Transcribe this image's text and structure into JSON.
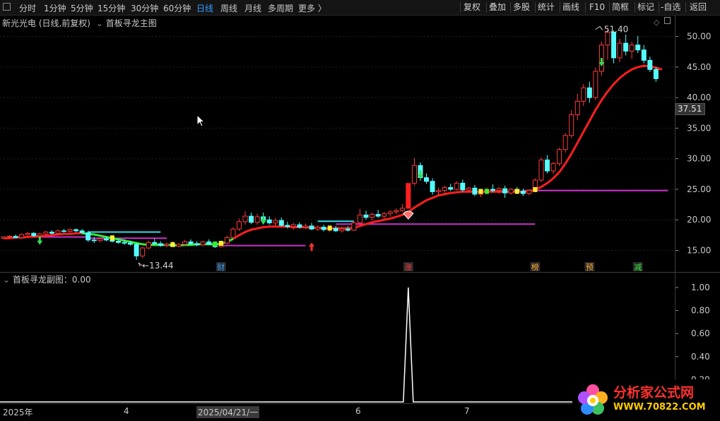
{
  "topbar": {
    "periods": [
      "分时",
      "1分钟",
      "5分钟",
      "15分钟",
      "30分钟",
      "60分钟",
      "日线",
      "周线",
      "月线",
      "多周期",
      "更多 〉"
    ],
    "active_period": "日线",
    "tools": [
      "复权",
      "叠加",
      "多股",
      "统计",
      "画线",
      "F10",
      "简框",
      "标记",
      "-自选",
      "返回"
    ]
  },
  "main": {
    "stock_title": "新光光电 (日线,前复权)",
    "indicator_name": "首板寻龙主图",
    "price_ticks": [
      "50.00",
      "45.00",
      "40.00",
      "35.00",
      "30.00",
      "25.00",
      "20.00",
      "15.00"
    ],
    "current_price_label": "37.51",
    "high_label": "51.40",
    "low_label": "13.44",
    "markers": [
      "财",
      "涨",
      "榜",
      "预",
      "减"
    ],
    "colors": {
      "up": "#ff3c3c",
      "down": "#54ffff",
      "ma": "#ff1e1e",
      "support": "#cc33cc",
      "cyan_line": "#33ddee",
      "green_line": "#33ee33",
      "background": "#000000"
    }
  },
  "sub": {
    "title": "首板寻龙副图：0.00",
    "ticks": [
      "1.00",
      "0.80",
      "0.60",
      "0.40",
      "0.20"
    ]
  },
  "xaxis": {
    "labels": [
      "2025年",
      "4",
      "2025/04/21/一",
      "6",
      "7"
    ]
  },
  "watermark": {
    "line1": "分析家公式网",
    "line2": "WWW.70822.COM"
  },
  "chart_data": {
    "type": "candlestick",
    "title": "新光光电 (日线,前复权)",
    "ylim": [
      12,
      53
    ],
    "price_ticks": [
      15,
      20,
      25,
      30,
      35,
      40,
      45,
      50
    ],
    "high": 51.4,
    "low": 13.44,
    "last": 37.51,
    "candles": [
      [
        17.0,
        17.3,
        16.8,
        17.2
      ],
      [
        17.2,
        17.5,
        17.0,
        17.3
      ],
      [
        17.3,
        17.6,
        17.0,
        17.1
      ],
      [
        17.1,
        17.8,
        17.0,
        17.6
      ],
      [
        17.6,
        18.0,
        17.4,
        17.8
      ],
      [
        17.8,
        18.0,
        17.2,
        17.4
      ],
      [
        17.4,
        17.9,
        17.2,
        17.7
      ],
      [
        17.7,
        18.2,
        17.5,
        18.0
      ],
      [
        18.0,
        18.3,
        17.6,
        17.8
      ],
      [
        17.8,
        18.4,
        17.6,
        18.2
      ],
      [
        18.2,
        18.5,
        17.9,
        18.1
      ],
      [
        18.1,
        18.6,
        17.9,
        18.4
      ],
      [
        18.4,
        18.6,
        18.0,
        18.2
      ],
      [
        18.2,
        18.5,
        17.8,
        17.9
      ],
      [
        17.9,
        18.2,
        16.4,
        16.7
      ],
      [
        16.7,
        17.2,
        16.2,
        16.6
      ],
      [
        16.6,
        17.1,
        16.3,
        16.9
      ],
      [
        16.9,
        17.3,
        16.5,
        16.7
      ],
      [
        16.7,
        17.0,
        16.3,
        16.5
      ],
      [
        16.5,
        16.9,
        16.1,
        16.3
      ],
      [
        16.3,
        16.8,
        15.9,
        16.2
      ],
      [
        16.2,
        16.6,
        15.8,
        16.0
      ],
      [
        16.0,
        16.3,
        13.44,
        14.1
      ],
      [
        14.1,
        15.6,
        13.8,
        15.4
      ],
      [
        15.4,
        16.6,
        15.2,
        16.3
      ],
      [
        16.3,
        16.9,
        15.9,
        16.1
      ],
      [
        16.1,
        16.5,
        15.6,
        15.8
      ],
      [
        15.8,
        16.3,
        15.5,
        16.0
      ],
      [
        16.0,
        16.4,
        15.6,
        15.7
      ],
      [
        15.7,
        16.2,
        15.5,
        16.0
      ],
      [
        16.0,
        16.7,
        15.8,
        16.4
      ],
      [
        16.4,
        16.8,
        15.9,
        16.1
      ],
      [
        16.1,
        16.5,
        15.7,
        15.9
      ],
      [
        15.9,
        16.6,
        15.7,
        16.4
      ],
      [
        16.4,
        16.8,
        15.9,
        16.0
      ],
      [
        16.0,
        16.4,
        15.4,
        15.6
      ],
      [
        15.6,
        16.4,
        15.5,
        16.2
      ],
      [
        16.2,
        17.4,
        16.0,
        17.1
      ],
      [
        17.1,
        18.8,
        16.9,
        18.5
      ],
      [
        18.5,
        20.2,
        18.2,
        19.7
      ],
      [
        19.7,
        21.4,
        19.2,
        20.6
      ],
      [
        20.6,
        21.2,
        19.3,
        19.6
      ],
      [
        19.6,
        21.0,
        19.2,
        20.5
      ],
      [
        20.5,
        21.2,
        19.7,
        20.0
      ],
      [
        20.0,
        20.6,
        19.2,
        19.5
      ],
      [
        19.5,
        20.3,
        19.0,
        19.9
      ],
      [
        19.9,
        20.4,
        18.9,
        19.1
      ],
      [
        19.1,
        19.7,
        18.6,
        18.9
      ],
      [
        18.9,
        19.5,
        18.4,
        19.2
      ],
      [
        19.2,
        19.6,
        18.6,
        18.8
      ],
      [
        18.8,
        19.4,
        18.5,
        19.0
      ],
      [
        19.0,
        19.5,
        18.3,
        18.5
      ],
      [
        18.5,
        19.1,
        18.2,
        18.8
      ],
      [
        18.8,
        19.2,
        18.1,
        18.4
      ],
      [
        18.4,
        18.9,
        18.0,
        18.6
      ],
      [
        18.6,
        19.0,
        18.0,
        18.2
      ],
      [
        18.2,
        18.8,
        17.9,
        18.5
      ],
      [
        18.5,
        19.0,
        18.1,
        18.3
      ],
      [
        18.3,
        19.8,
        18.2,
        19.5
      ],
      [
        19.5,
        21.8,
        19.3,
        20.8
      ],
      [
        20.8,
        21.5,
        20.0,
        20.4
      ],
      [
        20.4,
        21.2,
        19.9,
        20.9
      ],
      [
        20.9,
        21.6,
        20.3,
        20.6
      ],
      [
        20.6,
        21.3,
        20.1,
        21.0
      ],
      [
        21.0,
        21.6,
        20.5,
        21.3
      ],
      [
        21.3,
        21.9,
        20.9,
        21.5
      ],
      [
        21.5,
        22.6,
        21.3,
        21.9
      ],
      [
        21.9,
        25.96,
        21.9,
        25.96
      ],
      [
        26.0,
        30.1,
        25.6,
        28.9
      ],
      [
        28.9,
        29.4,
        26.4,
        26.9
      ],
      [
        26.9,
        27.6,
        25.9,
        26.3
      ],
      [
        26.3,
        26.8,
        24.1,
        24.6
      ],
      [
        24.6,
        25.3,
        23.9,
        24.8
      ],
      [
        24.8,
        25.6,
        24.3,
        25.3
      ],
      [
        25.3,
        25.9,
        24.7,
        25.0
      ],
      [
        25.0,
        26.3,
        24.8,
        26.0
      ],
      [
        26.0,
        26.6,
        24.6,
        24.9
      ],
      [
        24.9,
        25.4,
        24.5,
        25.2
      ],
      [
        25.2,
        25.7,
        23.9,
        24.2
      ],
      [
        24.2,
        24.9,
        23.7,
        24.7
      ],
      [
        24.7,
        25.3,
        24.2,
        25.0
      ],
      [
        25.0,
        25.8,
        24.5,
        24.8
      ],
      [
        24.8,
        25.4,
        24.3,
        25.1
      ],
      [
        25.1,
        25.6,
        23.6,
        24.4
      ],
      [
        24.4,
        25.2,
        24.1,
        25.0
      ],
      [
        25.0,
        25.4,
        24.5,
        24.7
      ],
      [
        24.7,
        25.1,
        23.9,
        24.3
      ],
      [
        24.3,
        25.0,
        24.0,
        24.8
      ],
      [
        24.8,
        26.8,
        24.6,
        26.5
      ],
      [
        26.5,
        30.2,
        26.2,
        29.8
      ],
      [
        29.8,
        30.6,
        27.6,
        28.0
      ],
      [
        28.0,
        29.5,
        27.5,
        29.2
      ],
      [
        29.2,
        31.8,
        28.8,
        31.5
      ],
      [
        31.5,
        34.2,
        31.0,
        33.8
      ],
      [
        33.8,
        37.9,
        33.4,
        37.2
      ],
      [
        37.2,
        40.6,
        36.3,
        39.4
      ],
      [
        39.4,
        42.2,
        38.6,
        41.6
      ],
      [
        41.6,
        42.6,
        39.2,
        40.0
      ],
      [
        40.0,
        44.9,
        39.6,
        44.3
      ],
      [
        44.3,
        49.2,
        43.6,
        48.6
      ],
      [
        48.6,
        51.4,
        46.2,
        50.7
      ],
      [
        50.7,
        51.0,
        45.6,
        46.5
      ],
      [
        46.5,
        49.6,
        45.8,
        48.9
      ],
      [
        48.9,
        50.3,
        46.9,
        47.6
      ],
      [
        47.6,
        49.2,
        46.3,
        48.6
      ],
      [
        48.6,
        50.1,
        47.3,
        47.8
      ],
      [
        47.8,
        48.6,
        45.6,
        46.1
      ],
      [
        46.1,
        46.7,
        44.2,
        44.6
      ],
      [
        44.6,
        45.0,
        42.6,
        43.1
      ]
    ],
    "ma_line": [
      17.0,
      17.0,
      17.1,
      17.1,
      17.2,
      17.3,
      17.3,
      17.4,
      17.5,
      17.6,
      17.7,
      17.7,
      17.8,
      17.8,
      17.7,
      17.6,
      17.4,
      17.2,
      17.0,
      16.8,
      16.6,
      16.4,
      16.2,
      16.0,
      15.9,
      15.9,
      15.9,
      15.9,
      15.9,
      15.8,
      15.9,
      15.9,
      16.0,
      16.0,
      16.0,
      16.0,
      16.1,
      16.4,
      16.9,
      17.5,
      18.0,
      18.4,
      18.6,
      18.8,
      18.9,
      18.9,
      18.9,
      18.9,
      18.8,
      18.8,
      18.8,
      18.7,
      18.7,
      18.6,
      18.6,
      18.6,
      18.6,
      18.6,
      18.7,
      19.0,
      19.3,
      19.6,
      19.8,
      20.0,
      20.2,
      20.5,
      20.8,
      21.3,
      22.0,
      22.6,
      23.2,
      23.6,
      24.0,
      24.2,
      24.4,
      24.5,
      24.6,
      24.6,
      24.6,
      24.6,
      24.6,
      24.6,
      24.6,
      24.6,
      24.6,
      24.6,
      24.6,
      24.7,
      24.9,
      25.4,
      26.0,
      26.8,
      27.8,
      29.2,
      30.8,
      32.6,
      34.4,
      36.2,
      38.0,
      39.6,
      41.0,
      42.2,
      43.2,
      44.0,
      44.6,
      45.0,
      45.2,
      45.1,
      44.9,
      44.6
    ],
    "support_lines": [
      {
        "start": 2,
        "end": 14,
        "value": 17.2
      },
      {
        "start": 14,
        "end": 27,
        "value": 18.0
      },
      {
        "start": 14,
        "end": 27,
        "value": 17.0
      },
      {
        "start": 36,
        "end": 50,
        "value": 15.8
      },
      {
        "start": 55,
        "end": 88,
        "value": 19.3
      },
      {
        "start": 86,
        "end": 110,
        "value": 24.8
      }
    ],
    "sub_series": {
      "name": "首板寻龙副图",
      "peak_index": 67,
      "peak_value": 1.0,
      "ylim": [
        0,
        1.1
      ]
    }
  }
}
